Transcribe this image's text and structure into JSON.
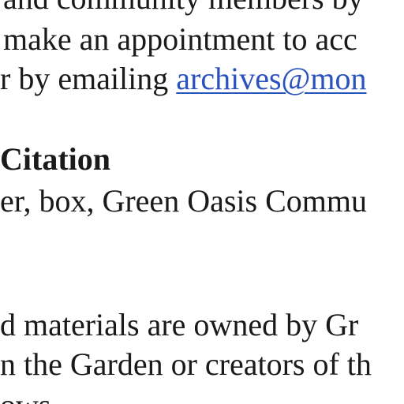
{
  "document": {
    "line0": "and community members by",
    "line1": "make an appointment to acc",
    "line2_prefix": "r by emailing ",
    "line2_link": "archives@mon",
    "heading": "Citation",
    "line4": "er, box, Green Oasis Commu",
    "line5": "d materials are owned by Gr",
    "line6": "n the Garden or creators of th",
    "line7": "ows"
  },
  "colors": {
    "text": "#1a1a1a",
    "link": "#2a52be",
    "background": "#ffffff"
  }
}
